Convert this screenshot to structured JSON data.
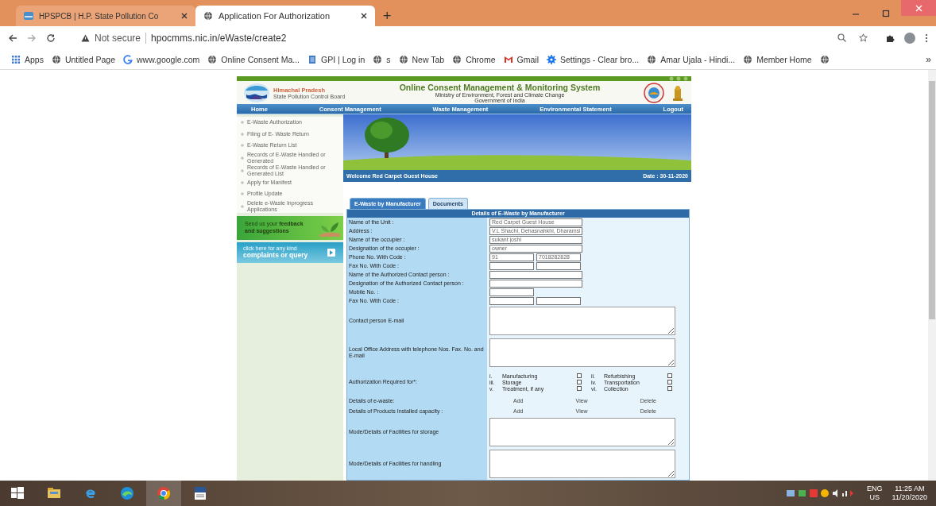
{
  "browser": {
    "tabs": [
      {
        "title": "HPSPCB | H.P. State Pollution Co",
        "selected": false
      },
      {
        "title": "Application For Authorization",
        "selected": true
      }
    ],
    "new_tab": "+",
    "address": {
      "security": "Not secure",
      "url": "hpocmms.nic.in/eWaste/create2"
    },
    "bookmarks": [
      {
        "label": "Apps"
      },
      {
        "label": "Untitled Page"
      },
      {
        "label": "www.google.com"
      },
      {
        "label": "Online Consent Ma..."
      },
      {
        "label": "GPI | Log in"
      },
      {
        "label": "s"
      },
      {
        "label": "New Tab"
      },
      {
        "label": "Chrome"
      },
      {
        "label": "Gmail"
      },
      {
        "label": "Settings - Clear bro..."
      },
      {
        "label": "Amar Ujala - Hindi..."
      },
      {
        "label": "Member Home"
      }
    ],
    "more": "»"
  },
  "site": {
    "org_name": "Himachal Pradesh",
    "org_sub": "State Pollution Control Board",
    "title": "Online Consent Management & Monitoring System",
    "ministry": "Ministry of Environment, Forest and Climate Change",
    "government": "Government of India",
    "nav": [
      "Home",
      "Consent Management",
      "Waste Management",
      "Environmental Statement",
      "Logout"
    ],
    "sidebar": [
      "E-Waste Authorization",
      "Filing of E- Waste Return",
      "E-Waste Return List",
      "Records of E-Waste Handled or Generated",
      "Records of E-Waste Handled or Generated List",
      "Apply for Manifest",
      "Profile Update",
      "Delete e-Waste Inprogress Applications"
    ],
    "feedback": "Send us your **feedback and suggestions**",
    "complaint_small": "click here for any kind",
    "complaint": "complaints or query",
    "welcome": "Welcome Red Carpet Guest House",
    "date": "Date : 30-11-2020",
    "form_tabs": [
      {
        "label": "E-Waste by Manufacturer",
        "selected": true
      },
      {
        "label": "Documents",
        "selected": false
      }
    ],
    "form_title": "Details of E-Waste by Manufacturer",
    "rows": [
      {
        "kind": "single",
        "label": "Name of the Unit :",
        "values": [
          "Red Carpet Guest House"
        ]
      },
      {
        "kind": "single",
        "label": "Address :",
        "values": [
          "V.L Shachi, Dehasnahkhi, Dharamsl"
        ]
      },
      {
        "kind": "single",
        "label": "Name of the occupier :",
        "values": [
          "sukant joshi"
        ]
      },
      {
        "kind": "single",
        "label": "Designation of the occupier :",
        "values": [
          "owner"
        ]
      },
      {
        "kind": "pair",
        "label": "Phone No. With Code :",
        "values": [
          "91",
          "7018282828"
        ]
      },
      {
        "kind": "pair",
        "label": "Fax No. With Code :"
      },
      {
        "kind": "single",
        "label": "Name of the Authorized Contact person :"
      },
      {
        "kind": "single",
        "label": "Designation of the Authorized Contact person :"
      },
      {
        "kind": "short",
        "label": "Mobile No. :"
      },
      {
        "kind": "pair",
        "label": "Fax No. With Code :"
      },
      {
        "kind": "textarea",
        "label": "Contact person E-mail"
      },
      {
        "kind": "textarea",
        "label": "Local Office Address with telephone Nos. Fax. No. and E-mail"
      },
      {
        "kind": "checks",
        "label": "Authorization Required for*:",
        "options": [
          {
            "num": "i.",
            "label": "Manufacturing",
            "checked": false
          },
          {
            "num": "ii.",
            "label": "Refurbishing",
            "checked": false
          },
          {
            "num": "iii.",
            "label": "Storage",
            "checked": false
          },
          {
            "num": "iv.",
            "label": "Transportation",
            "checked": false
          },
          {
            "num": "v.",
            "label": "Treatment, if any",
            "checked": false
          },
          {
            "num": "vi.",
            "label": "Collection",
            "checked": false
          }
        ]
      },
      {
        "kind": "links",
        "label": "Details of e-waste:",
        "links": [
          "Add",
          "View",
          "Delete"
        ]
      },
      {
        "kind": "links",
        "label": "Details of Products Installed capacity :",
        "links": [
          "Add",
          "View",
          "Delete"
        ]
      },
      {
        "kind": "textarea",
        "label": "Mode/Details of Facilities for storage"
      },
      {
        "kind": "textarea",
        "label": "Mode/Details of Facilities for handling"
      }
    ]
  },
  "taskbar": {
    "language": "ENG",
    "region": "US",
    "time": "11:25 AM",
    "date": "11/20/2020"
  }
}
